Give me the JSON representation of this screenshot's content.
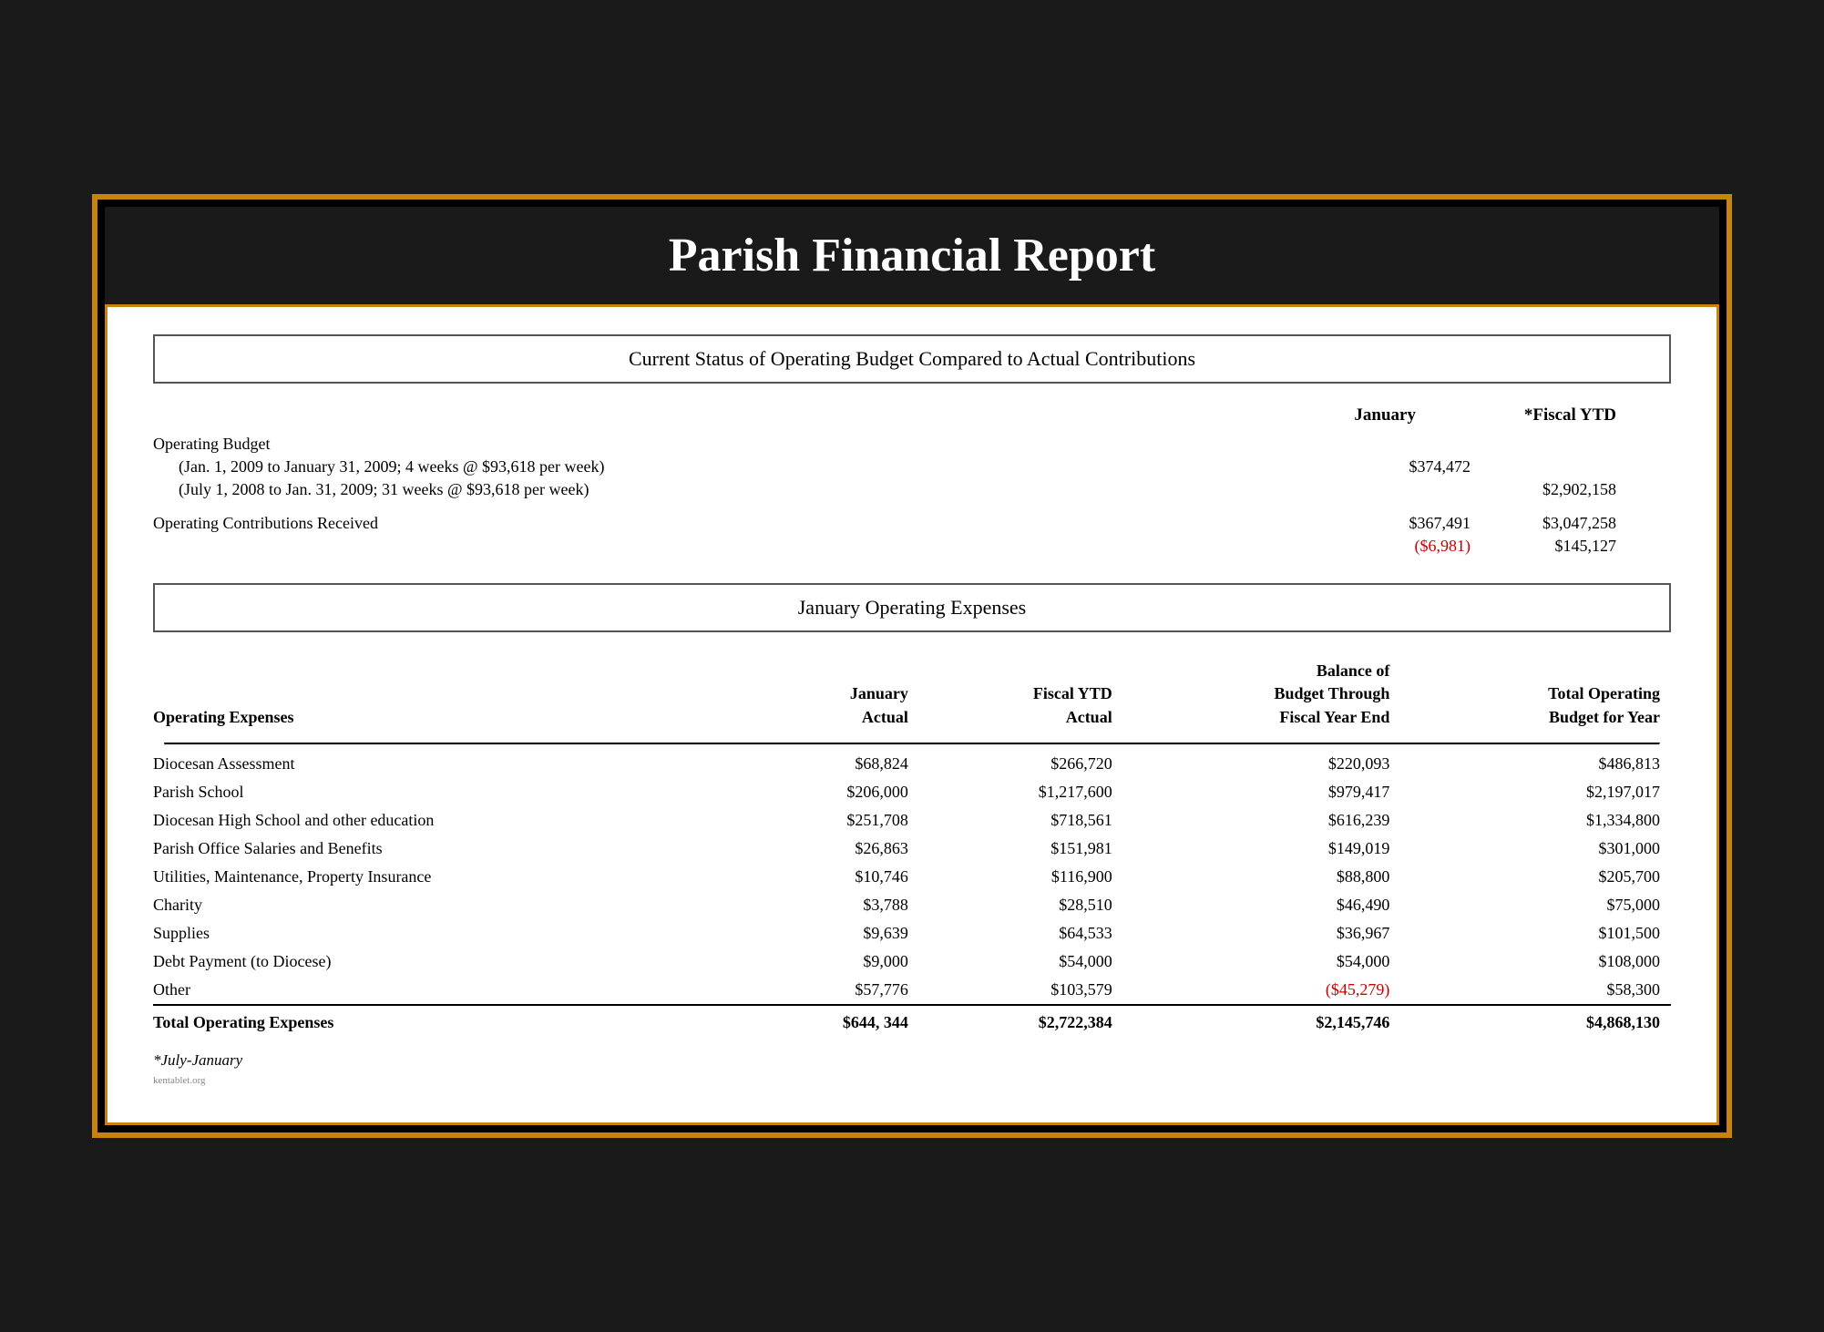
{
  "title": "Parish Financial Report",
  "topSection": {
    "boxTitle": "Current Status of Operating Budget Compared to Actual Contributions",
    "col1Header": "January",
    "col2Header": "*Fiscal YTD",
    "rows": [
      {
        "label": "Operating Budget",
        "indent": false,
        "janVal": "",
        "ytdVal": ""
      },
      {
        "label": "(Jan. 1, 2009 to January 31, 2009; 4 weeks @ $93,618 per week)",
        "indent": true,
        "janVal": "$374,472",
        "ytdVal": ""
      },
      {
        "label": "(July 1, 2008 to Jan. 31, 2009; 31 weeks @ $93,618 per week)",
        "indent": true,
        "janVal": "",
        "ytdVal": "$2,902,158"
      },
      {
        "label": "Operating Contributions Received",
        "indent": false,
        "janVal": "$367,491",
        "ytdVal": "$3,047,258"
      },
      {
        "label": "",
        "indent": false,
        "janVal": "($6,981)",
        "janRed": true,
        "ytdVal": "$145,127",
        "ytdRed": false
      }
    ]
  },
  "expensesSection": {
    "boxTitle": "January Operating Expenses",
    "headers": {
      "label": "Operating Expenses",
      "col1": "January\nActual",
      "col2": "Fiscal YTD\nActual",
      "col3": "Balance of\nBudget Through\nFiscal Year End",
      "col4": "Total Operating\nBudget for Year"
    },
    "rows": [
      {
        "label": "Diocesan Assessment",
        "col1": "$68,824",
        "col2": "$266,720",
        "col3": "$220,093",
        "col4": "$486,813",
        "col3Red": false
      },
      {
        "label": "Parish School",
        "col1": "$206,000",
        "col2": "$1,217,600",
        "col3": "$979,417",
        "col4": "$2,197,017",
        "col3Red": false
      },
      {
        "label": "Diocesan High School and other education",
        "col1": "$251,708",
        "col2": "$718,561",
        "col3": "$616,239",
        "col4": "$1,334,800",
        "col3Red": false
      },
      {
        "label": "Parish Office Salaries and Benefits",
        "col1": "$26,863",
        "col2": "$151,981",
        "col3": "$149,019",
        "col4": "$301,000",
        "col3Red": false
      },
      {
        "label": "Utilities, Maintenance, Property Insurance",
        "col1": "$10,746",
        "col2": "$116,900",
        "col3": "$88,800",
        "col4": "$205,700",
        "col3Red": false
      },
      {
        "label": "Charity",
        "col1": "$3,788",
        "col2": "$28,510",
        "col3": "$46,490",
        "col4": "$75,000",
        "col3Red": false
      },
      {
        "label": "Supplies",
        "col1": "$9,639",
        "col2": "$64,533",
        "col3": "$36,967",
        "col4": "$101,500",
        "col3Red": false
      },
      {
        "label": "Debt Payment (to Diocese)",
        "col1": "$9,000",
        "col2": "$54,000",
        "col3": "$54,000",
        "col4": "$108,000",
        "col3Red": false
      },
      {
        "label": "Other",
        "col1": "$57,776",
        "col2": "$103,579",
        "col3": "($45,279)",
        "col4": "$58,300",
        "col3Red": true
      }
    ],
    "totalRow": {
      "label": "Total Operating Expenses",
      "col1": "$644, 344",
      "col2": "$2,722,384",
      "col3": "$2,145,746",
      "col4": "$4,868,130"
    }
  },
  "footnote": "*July-January",
  "watermark": "kentablet.org"
}
